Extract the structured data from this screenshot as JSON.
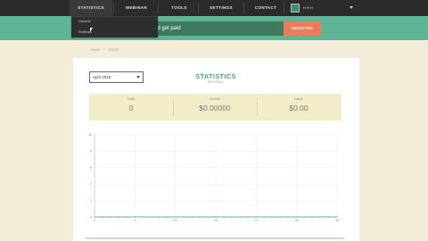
{
  "nav": {
    "statistics": "STATISTICS",
    "webinar": "WEBINAR",
    "tools": "TOOLS",
    "settings": "SETTINGS",
    "contact": "CONTACT",
    "user_name": "H H H"
  },
  "dropdown": {
    "general": "General",
    "refferals": "Refferals"
  },
  "banner": {
    "text": "nd get paid",
    "register_label": "REGISTER"
  },
  "breadcrumb": {
    "home": "Home",
    "separator": "/",
    "current": "STATS"
  },
  "card": {
    "date_value": "April 2016",
    "title": "STATISTICS",
    "subtitle": "REFERRAL"
  },
  "stats": {
    "visits_label": "Visits",
    "visits_value": "0",
    "income_label": "Income",
    "income_value": "$0.00000",
    "latest_label": "Latest",
    "latest_value": "$0.00"
  },
  "chart_data": {
    "type": "line",
    "x_ticks": [
      "0",
      "5",
      "10",
      "15",
      "20",
      "25",
      "30"
    ],
    "y_ticks": [
      "0",
      "2",
      "4",
      "6",
      "8",
      "10"
    ],
    "xlim": [
      0,
      30
    ],
    "ylim": [
      0,
      10
    ],
    "grid": true,
    "series": [
      {
        "values": [
          0,
          0,
          0,
          0,
          0,
          0,
          0,
          0,
          0,
          0,
          0,
          0,
          0,
          0,
          0,
          0,
          0,
          0,
          0,
          0,
          0,
          0,
          0,
          0,
          0,
          0,
          0,
          0,
          0,
          0,
          0
        ]
      }
    ]
  },
  "colors": {
    "nav_bg": "#2b2b2b",
    "banner_bg": "#5db595",
    "accent_green": "#4aa57f",
    "register_bg": "#ee7a5c",
    "stats_bg": "#f3ecc8",
    "page_bg": "#f2ecd9"
  }
}
